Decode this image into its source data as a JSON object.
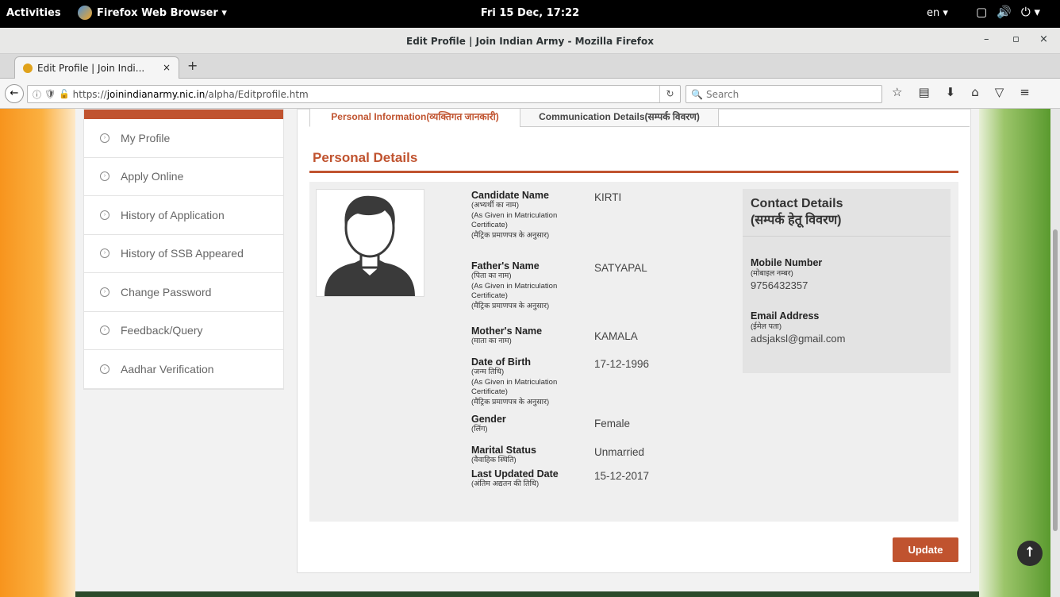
{
  "system": {
    "activities": "Activities",
    "app_name": "Firefox Web Browser ▾",
    "clock": "Fri 15 Dec, 17:22",
    "lang": "en ▾"
  },
  "window": {
    "title": "Edit Profile | Join Indian Army - Mozilla Firefox"
  },
  "browser": {
    "tab_label": "Edit Profile | Join Indi...",
    "url_prefix": "https://",
    "url_domain": "joinindianarmy.nic.in",
    "url_path": "/alpha/Editprofile.htm",
    "search_placeholder": "Search"
  },
  "sidebar": {
    "items": [
      {
        "label": "My Profile"
      },
      {
        "label": "Apply Online"
      },
      {
        "label": "History of Application"
      },
      {
        "label": "History of SSB Appeared"
      },
      {
        "label": "Change Password"
      },
      {
        "label": "Feedback/Query"
      },
      {
        "label": "Aadhar Verification"
      }
    ]
  },
  "tabs": {
    "personal": "Personal Information(व्यक्तिगत जानकारी)",
    "communication": "Communication Details(सम्पर्क विवरण)"
  },
  "section_title": "Personal Details",
  "fields": [
    {
      "label": "Candidate Name",
      "sub": [
        "(अभ्यर्थी का नाम)",
        "(As Given in Matriculation",
        "Certificate)",
        "(मैट्रिक प्रमाणपत्र के अनुसार)"
      ],
      "value": "KIRTI"
    },
    {
      "label": "Father's Name",
      "sub": [
        "(पिता का नाम)",
        "(As Given in Matriculation",
        "Certificate)",
        "(मैट्रिक प्रमाणपत्र के अनुसार)"
      ],
      "value": "SATYAPAL"
    },
    {
      "label": "Mother's Name",
      "sub": [
        "(माता का नाम)"
      ],
      "value": "KAMALA"
    },
    {
      "label": "Date of Birth",
      "sub": [
        "(जन्म तिथि)",
        "(As Given in Matriculation",
        "Certificate)",
        "(मैट्रिक प्रमाणपत्र के अनुसार)"
      ],
      "value": "17-12-1996"
    },
    {
      "label": "Gender",
      "sub": [
        "(लिंग)"
      ],
      "value": "Female"
    },
    {
      "label": "Marital Status",
      "sub": [
        "(वैवाहिक स्थिति)"
      ],
      "value": "Unmarried"
    },
    {
      "label": "Last Updated Date",
      "sub": [
        "(अंतिम अद्यतन की तिथि)"
      ],
      "value": "15-12-2017"
    }
  ],
  "contact": {
    "title": "Contact Details",
    "title_hi": "(सम्पर्क हेतू विवरण)",
    "mobile_label": "Mobile Number",
    "mobile_sub": "(मोबाइल नम्बर)",
    "mobile_value": "9756432357",
    "email_label": "Email Address",
    "email_sub": "(ईमेल पता)",
    "email_value": "adsjaksl@gmail.com"
  },
  "update_label": "Update",
  "colors": {
    "accent": "#c0532f"
  }
}
